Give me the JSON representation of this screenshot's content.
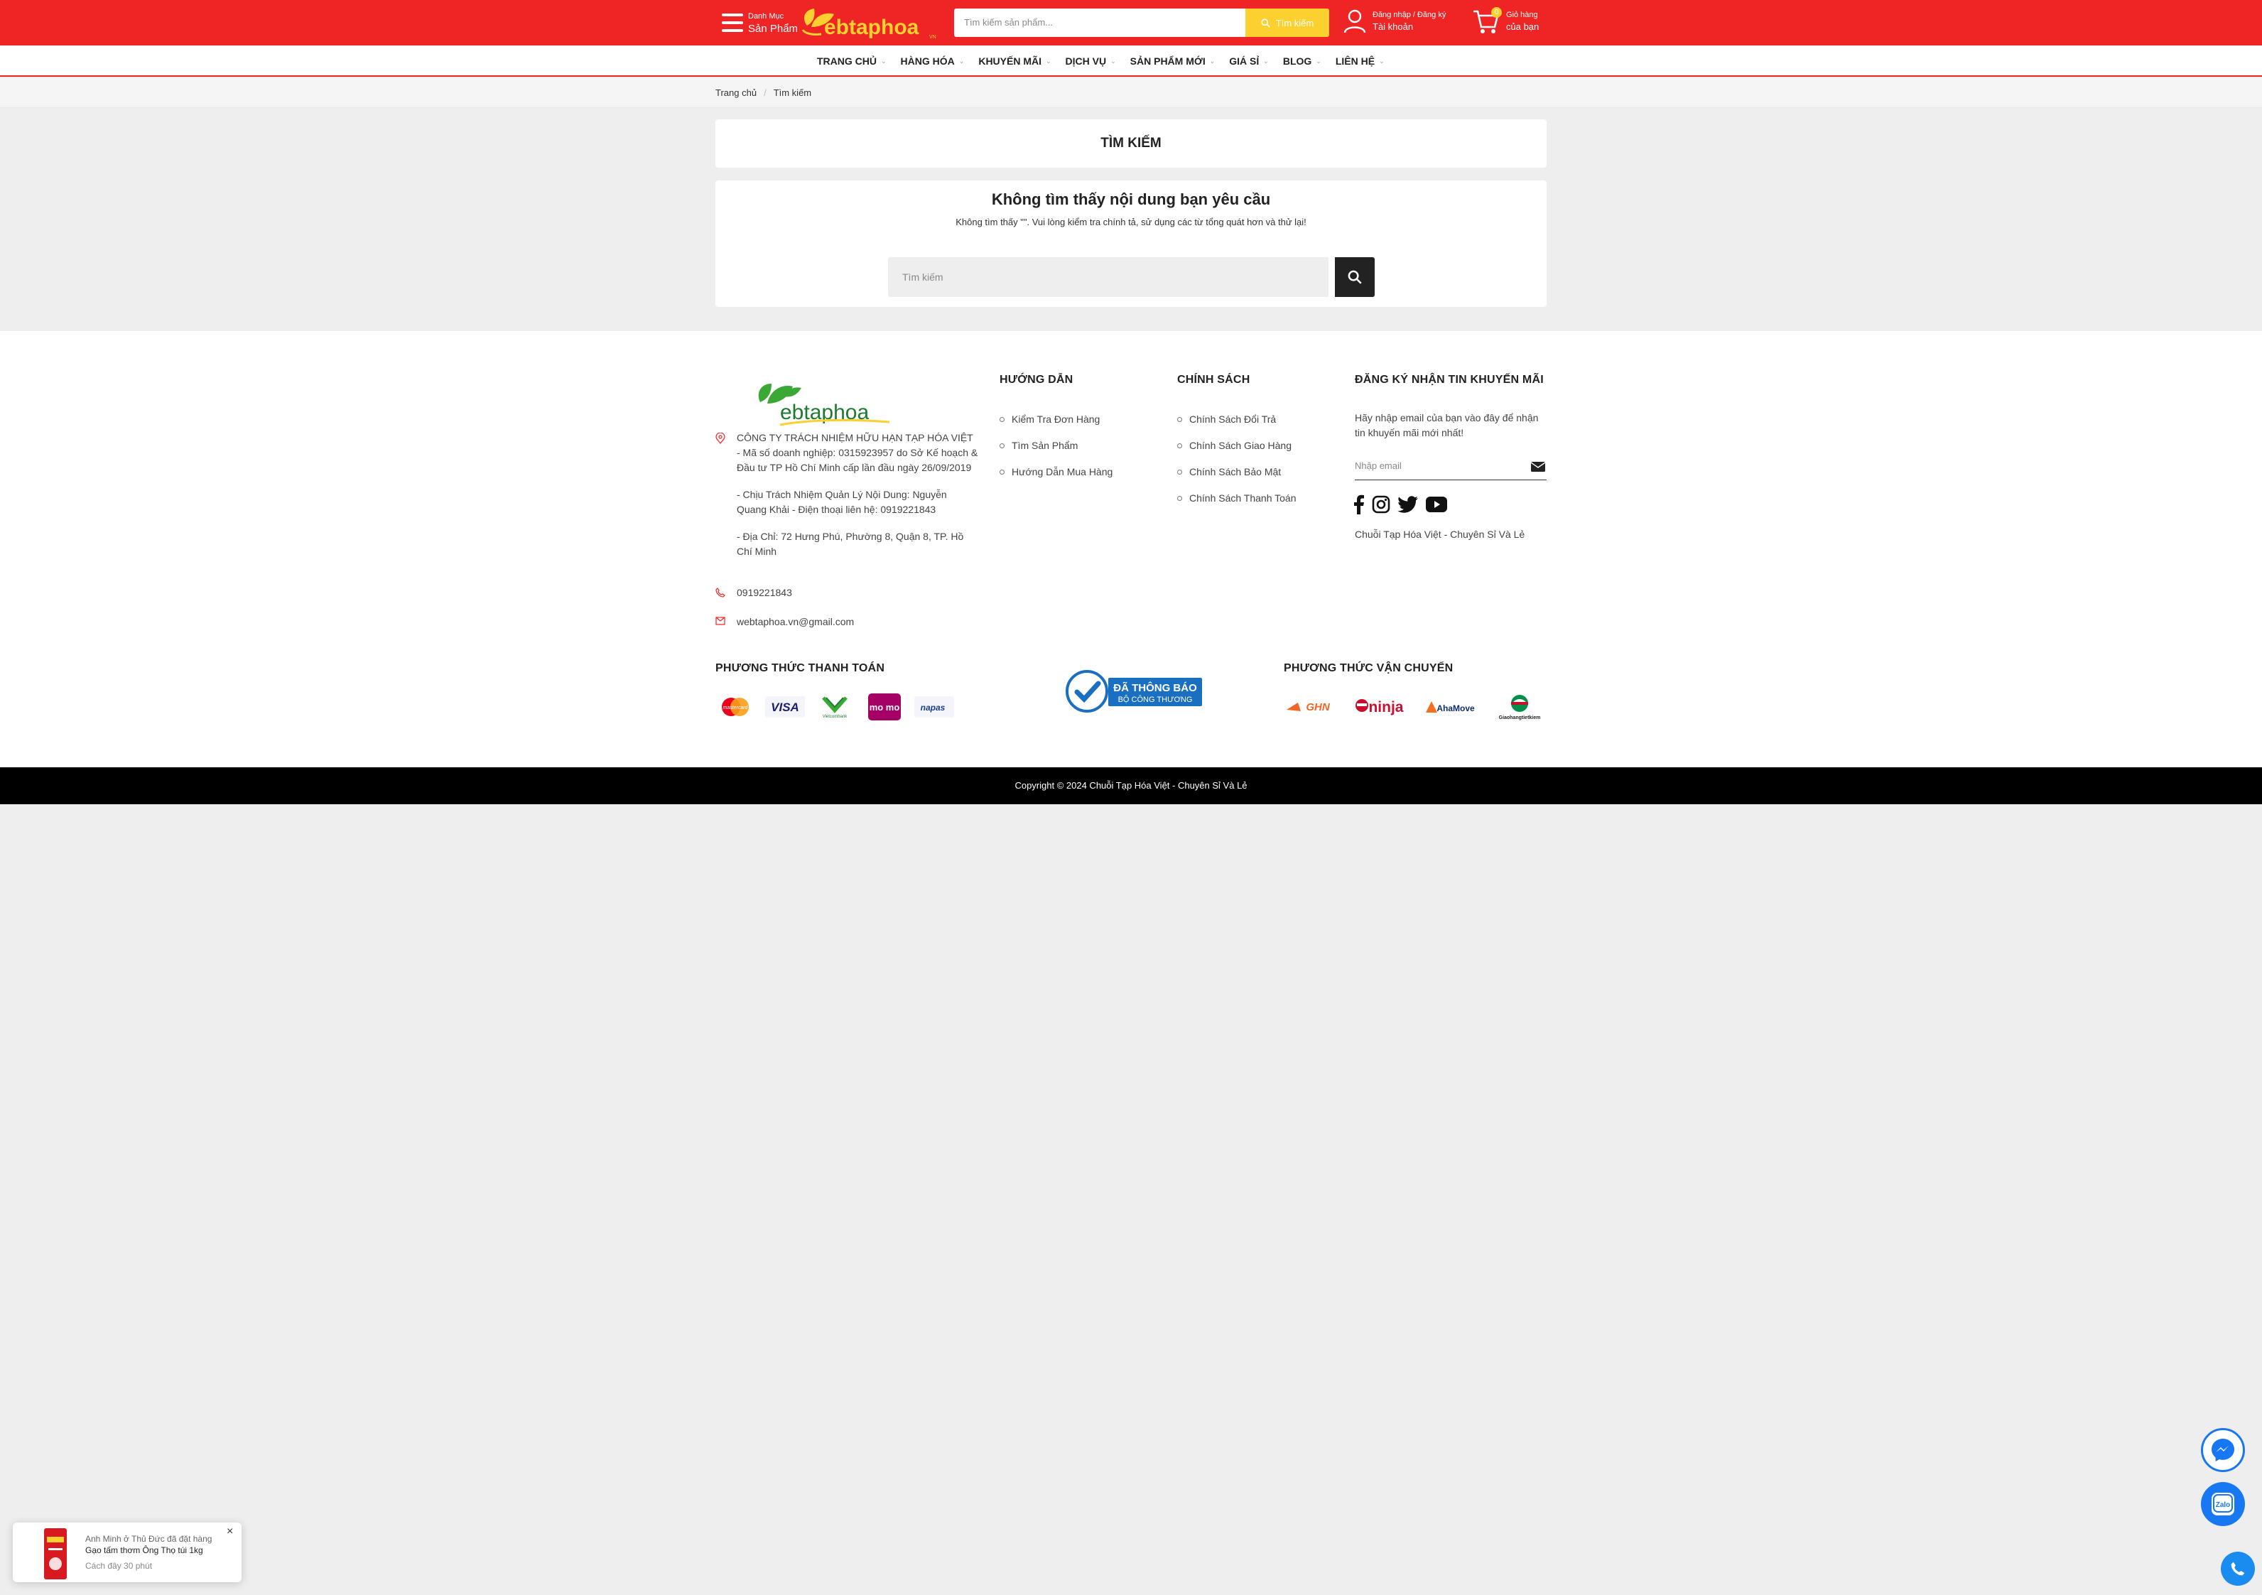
{
  "header": {
    "category_small": "Danh Mục",
    "category_big": "Sản Phẩm",
    "logo_text": "ebtaphoa",
    "logo_suffix": "VN",
    "search_placeholder": "Tìm kiếm sản phẩm...",
    "search_button": "Tìm kiếm",
    "account_line1": "Đăng nhập / Đăng ký",
    "account_line2": "Tài khoản",
    "cart_count": "0",
    "cart_line1": "Giỏ hàng",
    "cart_line2": "của bạn",
    "brand_color": "#ef2525",
    "accent_color": "#fbd02f"
  },
  "nav": {
    "items": [
      {
        "label": "TRANG CHỦ"
      },
      {
        "label": "HÀNG HÓA"
      },
      {
        "label": "KHUYẾN MÃI"
      },
      {
        "label": "DỊCH VỤ"
      },
      {
        "label": "SẢN PHẨM MỚI"
      },
      {
        "label": "GIÁ SỈ"
      },
      {
        "label": "BLOG"
      },
      {
        "label": "LIÊN HỆ"
      }
    ]
  },
  "breadcrumb": {
    "home": "Trang chủ",
    "current": "Tìm kiếm"
  },
  "main": {
    "page_title": "TÌM KIẾM",
    "result_heading": "Không tìm thấy nội dung bạn yêu cầu",
    "result_message": "Không tìm thấy \"\". Vui lòng kiểm tra chính tả, sử dụng các từ tổng quát hơn và thử lại!",
    "search_placeholder": "Tìm kiếm"
  },
  "footer": {
    "logo_text": "ebtaphoa",
    "company": [
      "CÔNG TY TRÁCH NHIỆM HỮU HẠN TẠP HÓA VIỆT - Mã số doanh nghiệp: 0315923957 do Sở Kế hoạch & Đầu tư TP Hồ Chí Minh cấp lần đầu ngày 26/09/2019",
      "- Chịu Trách Nhiệm Quản Lý Nội Dung: Nguyễn Quang Khải - Điện thoại liên hệ: 0919221843",
      "- Địa Chỉ: 72 Hưng Phú, Phường 8, Quận 8, TP. Hồ Chí Minh"
    ],
    "phone": "0919221843",
    "email": "webtaphoa.vn@gmail.com",
    "guide_title": "HƯỚNG DẪN",
    "guide_links": [
      "Kiểm Tra Đơn Hàng",
      "Tìm Sản Phẩm",
      "Hướng Dẫn Mua Hàng"
    ],
    "policy_title": "CHÍNH SÁCH",
    "policy_links": [
      "Chính Sách Đổi Trả",
      "Chính Sách Giao Hàng",
      "Chính Sách Bảo Mật",
      "Chính Sách Thanh Toán"
    ],
    "newsletter_title": "ĐĂNG KÝ NHẬN TIN KHUYẾN MÃI",
    "newsletter_desc": "Hãy nhập email của bạn vào đây để nhận tin khuyến mãi mới nhất!",
    "newsletter_placeholder": "Nhập email",
    "tagline": "Chuỗi Tạp Hóa Việt - Chuyên Sỉ Và Lẻ",
    "payment_title": "PHƯƠNG THỨC THANH TOÁN",
    "payments": [
      "mastercard",
      "VISA",
      "Vietcombank",
      "mo mo",
      "napas"
    ],
    "bct_line1": "ĐÃ THÔNG BÁO",
    "bct_line2": "BỘ CÔNG THƯƠNG",
    "shipping_title": "PHƯƠNG THỨC VẬN CHUYỂN",
    "shippers": [
      "GHN",
      "ninja",
      "AhaMove",
      "Giaohangtietkiem"
    ],
    "copyright": "Copyright © 2024 Chuỗi Tạp Hóa Việt - Chuyên Sỉ Và Lẻ"
  },
  "toast": {
    "line1": "Anh Minh ở Thủ Đức đã đặt hàng",
    "line2": "Gạo tấm thơm Ông Thọ túi 1kg",
    "line3": "Cách đây 30 phút",
    "close": "×"
  },
  "widgets": {
    "zalo_label": "Zalo"
  }
}
